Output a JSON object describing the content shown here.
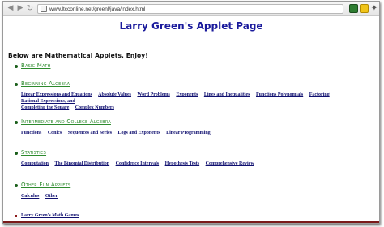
{
  "browser": {
    "url": "www.ltcconline.net/greenl/java/index.html"
  },
  "page": {
    "title": "Larry Green's Applet Page",
    "intro": "Below are Mathematical Applets.   Enjoy!"
  },
  "sections": [
    {
      "heading": "Basic Math",
      "links": []
    },
    {
      "heading": "Beginning Algebra",
      "links": [
        "Linear Expressions and Equations",
        "Absolute Values",
        "Word Problems",
        "Exponents",
        "Lines and Inequalities",
        "Functions Polynomials",
        "Factoring",
        "Rational Expressions, and",
        "Completing the Square",
        "Complex Numbers"
      ]
    },
    {
      "heading": "Intermediate and College Algebra",
      "links": [
        "Functions",
        "Conics",
        "Sequences and Series",
        "Logs and Exponents",
        "Linear Programming"
      ]
    },
    {
      "heading": "Statistics",
      "links": [
        "Computation",
        "The Binomial Distribution",
        "Confidence Intervals",
        "Hypothesis Tests",
        "Comprehensive Review"
      ]
    },
    {
      "heading": "Other Fun Applets",
      "links": [
        "Calculus",
        "Other"
      ]
    }
  ],
  "footer_link": "Larry Green's Math Games",
  "icons": {
    "back": "back-arrow-icon",
    "forward": "forward-arrow-icon",
    "reload": "reload-icon",
    "page": "page-icon",
    "extension": "extension-icon",
    "settings": "wrench-icon"
  }
}
